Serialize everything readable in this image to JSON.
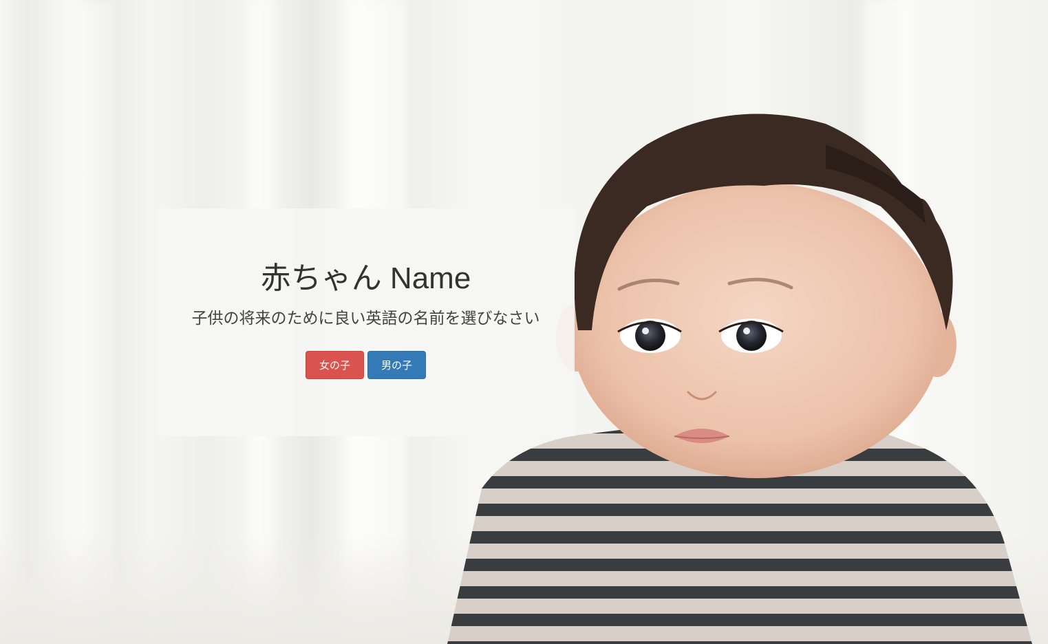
{
  "hero": {
    "title": "赤ちゃん Name",
    "subtitle": "子供の将来のために良い英語の名前を選びなさい",
    "buttons": {
      "girl_label": "女の子",
      "boy_label": "男の子"
    }
  },
  "colors": {
    "girl_button": "#d9534f",
    "boy_button": "#337ab7",
    "panel_bg": "#f6f6f4",
    "title_text": "#333333"
  },
  "icons": {
    "background": "baby-photo"
  }
}
